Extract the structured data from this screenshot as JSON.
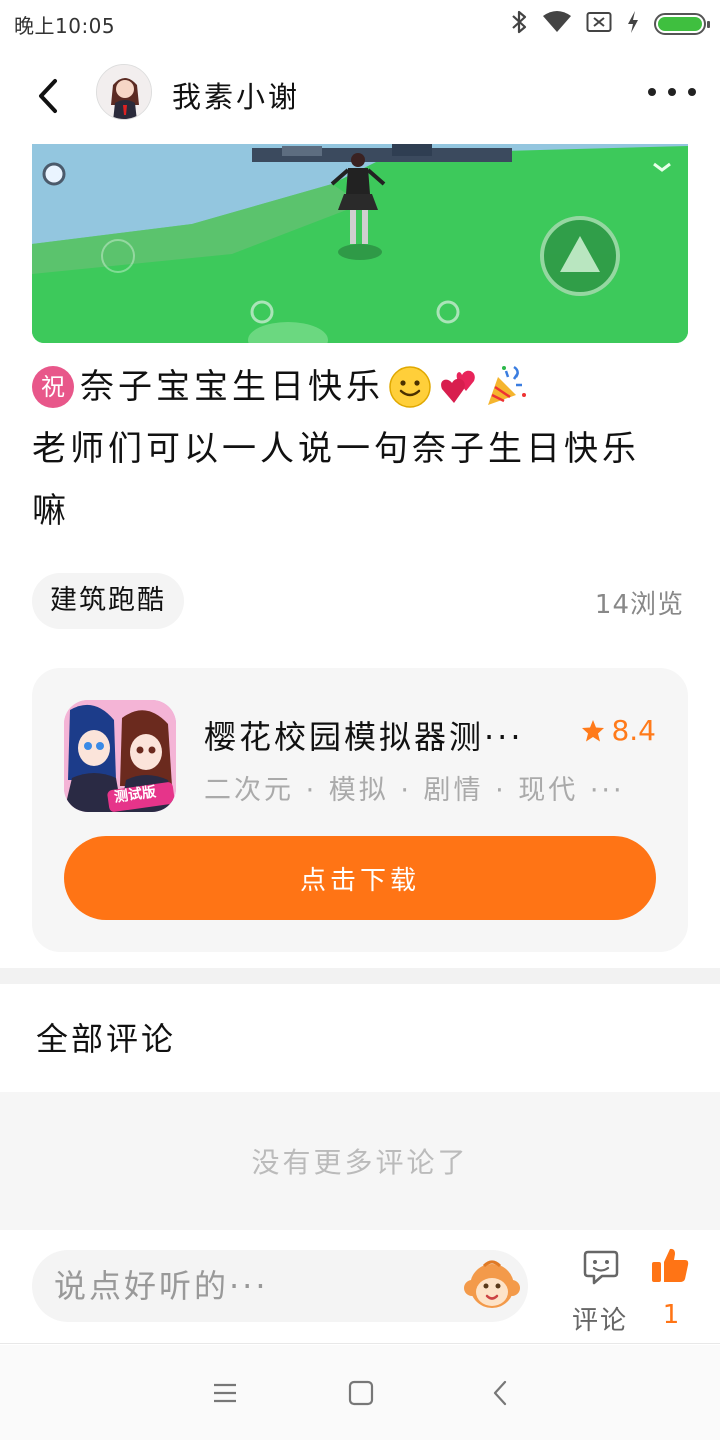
{
  "status_bar": {
    "time": "晚上10:05",
    "icons": [
      "bluetooth-icon",
      "wifi-icon",
      "sim-off-icon",
      "charging-icon",
      "battery-icon"
    ],
    "battery_color": "#3fbf3f"
  },
  "header": {
    "author_name": "我素小谢",
    "back_icon": "chevron-left-icon",
    "more_icon": "more-dots-icon"
  },
  "post": {
    "line1_badge": "祝",
    "line1_text": "奈子宝宝生日快乐",
    "line1_emojis": [
      "smile-emoji",
      "hearts-emoji",
      "party-popper-emoji"
    ],
    "line2_text": "老师们可以一人说一句奈子生日快乐",
    "line3_text": "嘛",
    "tag": "建筑跑酷",
    "views": "14浏览"
  },
  "app_card": {
    "name": "樱花校园模拟器测···",
    "rating": "8.4",
    "tags": "二次元 · 模拟 · 剧情 · 现代 ···",
    "icon_badge": "测试版",
    "download_label": "点击下载",
    "accent_color": "#ff7415"
  },
  "comments": {
    "title": "全部评论",
    "empty_text": "没有更多评论了"
  },
  "bottom_bar": {
    "input_placeholder": "说点好听的···",
    "comment_label": "评论",
    "like_count": "1"
  },
  "nav_bar": {
    "icons": [
      "menu-icon",
      "home-square-icon",
      "back-triangle-icon"
    ]
  }
}
